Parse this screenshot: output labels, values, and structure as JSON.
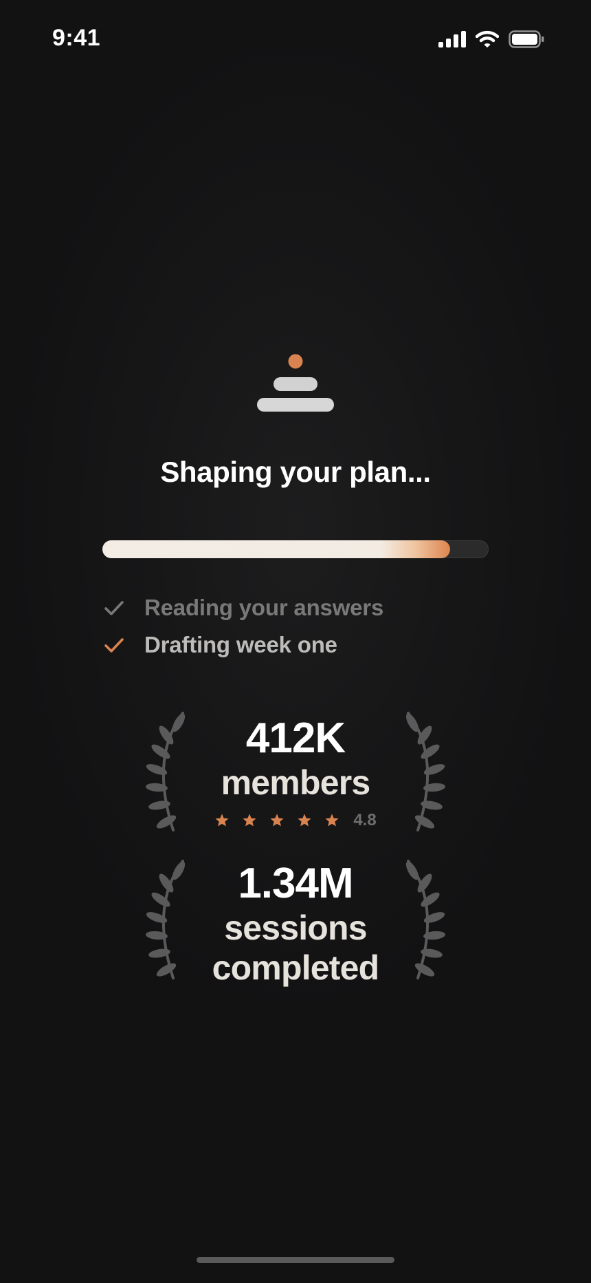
{
  "status_bar": {
    "time": "9:41",
    "icons": [
      "cellular-signal-icon",
      "wifi-icon",
      "battery-icon"
    ]
  },
  "loading": {
    "logo_icon": "stacked-stones-icon",
    "headline": "Shaping your plan...",
    "progress": 0.9,
    "steps": [
      {
        "label": "Reading your answers",
        "state": "done",
        "icon": "check-icon"
      },
      {
        "label": "Drafting week one",
        "state": "active",
        "icon": "check-icon"
      }
    ]
  },
  "stats": [
    {
      "value": "412K",
      "label": "members",
      "rating": {
        "stars": 5,
        "value": "4.8"
      }
    },
    {
      "value": "1.34M",
      "label": "sessions completed"
    }
  ],
  "colors": {
    "accent": "#D98450",
    "background": "#121212",
    "text_primary": "#FFFFFF",
    "text_muted": "#79797A",
    "progress_fill": "#F3EDE6",
    "laurel": "#5C5C5D"
  }
}
